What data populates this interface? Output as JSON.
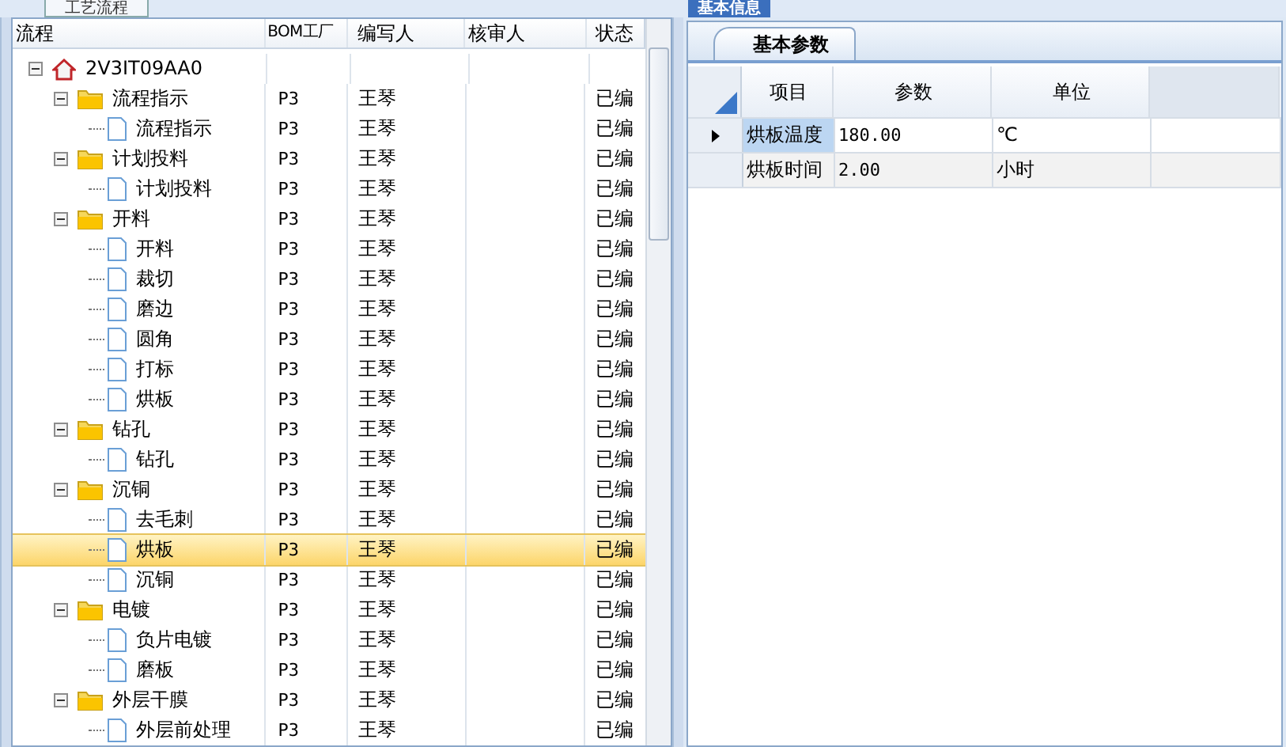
{
  "left_tab": {
    "label": "工艺流程"
  },
  "tree": {
    "columns": [
      "流程",
      "BOM工厂",
      "编写人",
      "核审人",
      "状态"
    ],
    "root": {
      "name": "2V3IT09AA0",
      "expanded": true,
      "selected": false,
      "children": [
        {
          "name": "流程指示",
          "factory": "P3",
          "writer": "王琴",
          "status": "已编",
          "expanded": true,
          "selected": false,
          "children": [
            {
              "name": "流程指示",
              "factory": "P3",
              "writer": "王琴",
              "status": "已编",
              "selected": false
            }
          ]
        },
        {
          "name": "计划投料",
          "factory": "P3",
          "writer": "王琴",
          "status": "已编",
          "expanded": true,
          "selected": false,
          "children": [
            {
              "name": "计划投料",
              "factory": "P3",
              "writer": "王琴",
              "status": "已编",
              "selected": false
            }
          ]
        },
        {
          "name": "开料",
          "factory": "P3",
          "writer": "王琴",
          "status": "已编",
          "expanded": true,
          "selected": false,
          "children": [
            {
              "name": "开料",
              "factory": "P3",
              "writer": "王琴",
              "status": "已编",
              "selected": false
            },
            {
              "name": "裁切",
              "factory": "P3",
              "writer": "王琴",
              "status": "已编",
              "selected": false
            },
            {
              "name": "磨边",
              "factory": "P3",
              "writer": "王琴",
              "status": "已编",
              "selected": false
            },
            {
              "name": "圆角",
              "factory": "P3",
              "writer": "王琴",
              "status": "已编",
              "selected": false
            },
            {
              "name": "打标",
              "factory": "P3",
              "writer": "王琴",
              "status": "已编",
              "selected": false
            },
            {
              "name": "烘板",
              "factory": "P3",
              "writer": "王琴",
              "status": "已编",
              "selected": false
            }
          ]
        },
        {
          "name": "钻孔",
          "factory": "P3",
          "writer": "王琴",
          "status": "已编",
          "expanded": true,
          "selected": false,
          "children": [
            {
              "name": "钻孔",
              "factory": "P3",
              "writer": "王琴",
              "status": "已编",
              "selected": false
            }
          ]
        },
        {
          "name": "沉铜",
          "factory": "P3",
          "writer": "王琴",
          "status": "已编",
          "expanded": true,
          "selected": false,
          "children": [
            {
              "name": "去毛刺",
              "factory": "P3",
              "writer": "王琴",
              "status": "已编",
              "selected": false
            },
            {
              "name": "烘板",
              "factory": "P3",
              "writer": "王琴",
              "status": "已编",
              "selected": true
            },
            {
              "name": "沉铜",
              "factory": "P3",
              "writer": "王琴",
              "status": "已编",
              "selected": false
            }
          ]
        },
        {
          "name": "电镀",
          "factory": "P3",
          "writer": "王琴",
          "status": "已编",
          "expanded": true,
          "selected": false,
          "children": [
            {
              "name": "负片电镀",
              "factory": "P3",
              "writer": "王琴",
              "status": "已编",
              "selected": false
            },
            {
              "name": "磨板",
              "factory": "P3",
              "writer": "王琴",
              "status": "已编",
              "selected": false
            }
          ]
        },
        {
          "name": "外层干膜",
          "factory": "P3",
          "writer": "王琴",
          "status": "已编",
          "expanded": true,
          "selected": false,
          "children": [
            {
              "name": "外层前处理",
              "factory": "P3",
              "writer": "王琴",
              "status": "已编",
              "selected": false
            }
          ]
        }
      ]
    }
  },
  "right_tab": {
    "label": "基本信息"
  },
  "sub_tab": {
    "label": "基本参数"
  },
  "params": {
    "columns": [
      "项目",
      "参数",
      "单位"
    ],
    "rows": [
      {
        "item": "烘板温度",
        "value": "180.00",
        "unit": "℃",
        "current": true
      },
      {
        "item": "烘板时间",
        "value": "2.00",
        "unit": "小时",
        "current": false
      }
    ]
  }
}
